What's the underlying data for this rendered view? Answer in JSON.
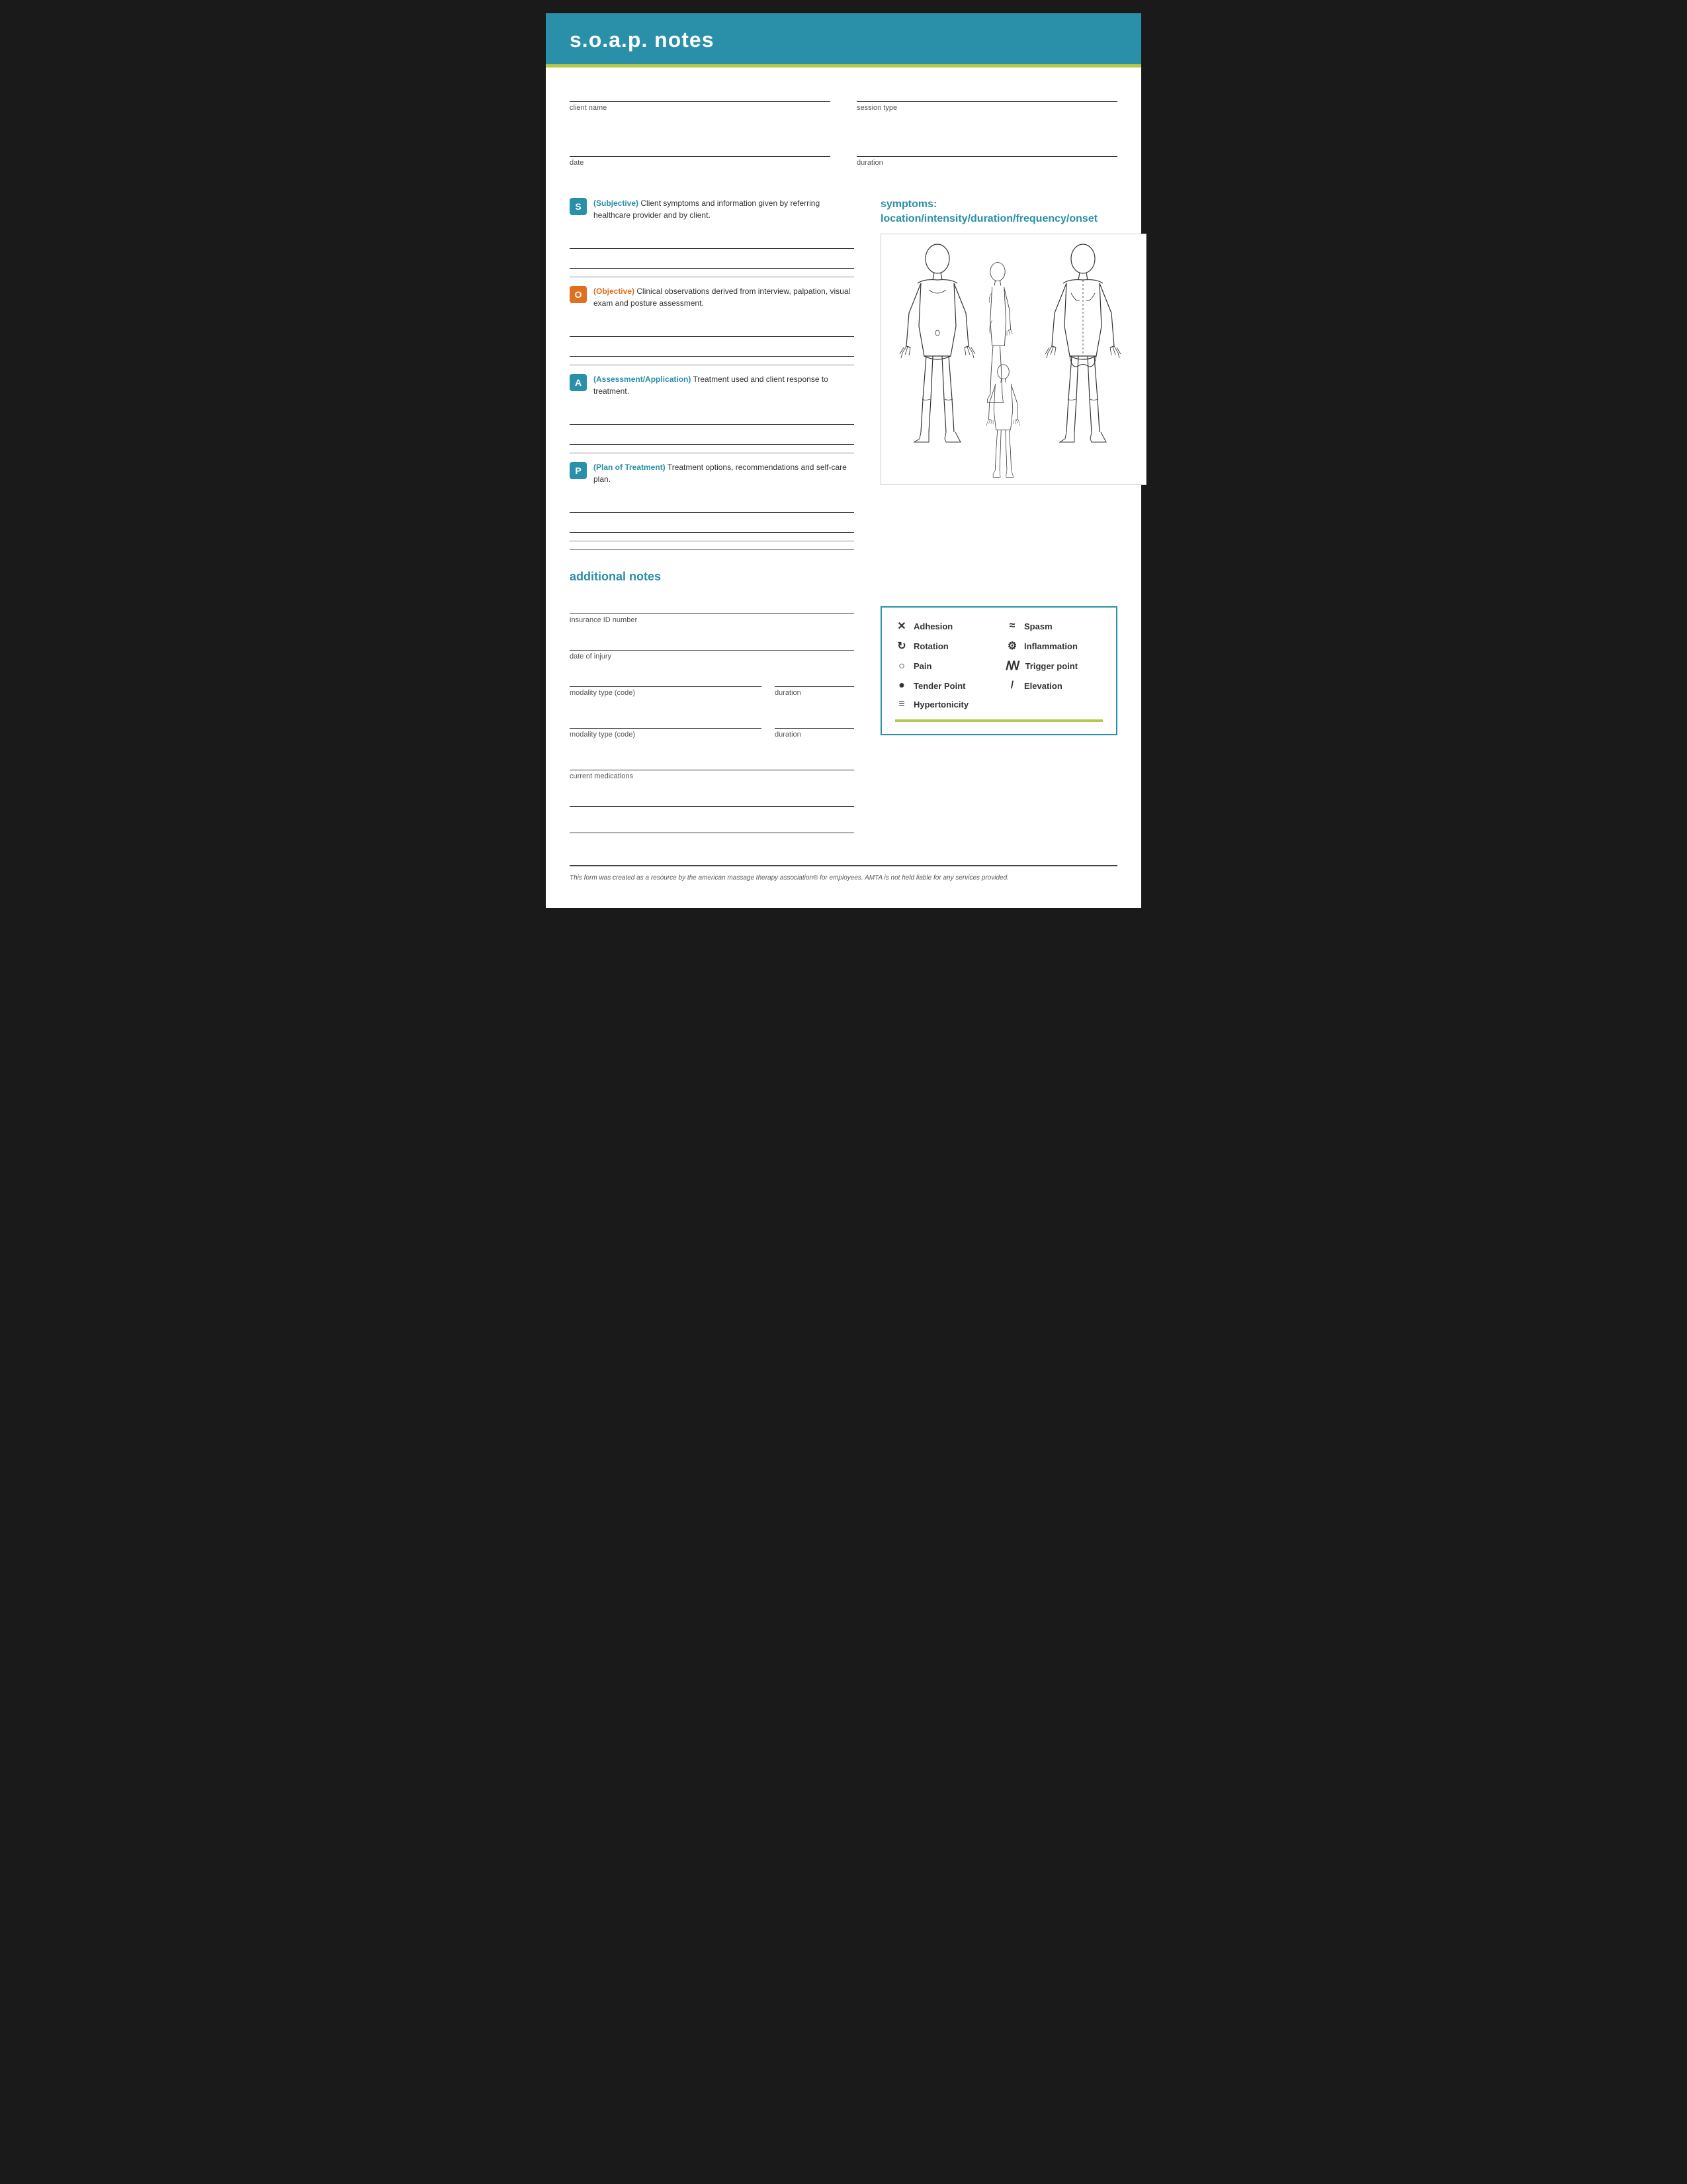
{
  "header": {
    "title": "s.o.a.p. notes"
  },
  "form": {
    "client_name_label": "client name",
    "date_label": "date",
    "session_type_label": "session type",
    "duration_label": "duration"
  },
  "soap": {
    "s": {
      "badge": "S",
      "label": "(Subjective)",
      "text": "Client symptoms and information given by referring healthcare provider and by client."
    },
    "o": {
      "badge": "O",
      "label": "(Objective)",
      "text": "Clinical observations derived from interview, palpation, visual exam and posture assessment."
    },
    "a": {
      "badge": "A",
      "label": "(Assessment/Application)",
      "text": "Treatment used and client response to treatment."
    },
    "p": {
      "badge": "P",
      "label": "(Plan of Treatment)",
      "text": "Treatment options, recommendations and self-care plan."
    }
  },
  "symptoms": {
    "title_line1": "symptoms:",
    "title_line2": "location/intensity/duration/frequency/onset"
  },
  "additional_notes": {
    "title": "additional notes"
  },
  "bottom_fields": {
    "insurance_id_label": "insurance ID number",
    "date_of_injury_label": "date of injury",
    "modality_type_label": "modality type (code)",
    "duration_label": "duration",
    "current_medications_label": "current medications"
  },
  "legend": {
    "items": [
      {
        "symbol": "✕",
        "label": "Adhesion"
      },
      {
        "symbol": "≈",
        "label": "Spasm"
      },
      {
        "symbol": "↻",
        "label": "Rotation"
      },
      {
        "symbol": "⚙",
        "label": "Inflammation"
      },
      {
        "symbol": "○",
        "label": "Pain"
      },
      {
        "symbol": "ꟿ",
        "label": "Trigger point"
      },
      {
        "symbol": "●",
        "label": "Tender Point"
      },
      {
        "symbol": "/",
        "label": "Elevation"
      },
      {
        "symbol": "≡",
        "label": "Hypertonicity"
      }
    ]
  },
  "footer": {
    "text": "This form was created as a resource by the american massage therapy association® for employees. AMTA is not held liable for any services provided."
  }
}
